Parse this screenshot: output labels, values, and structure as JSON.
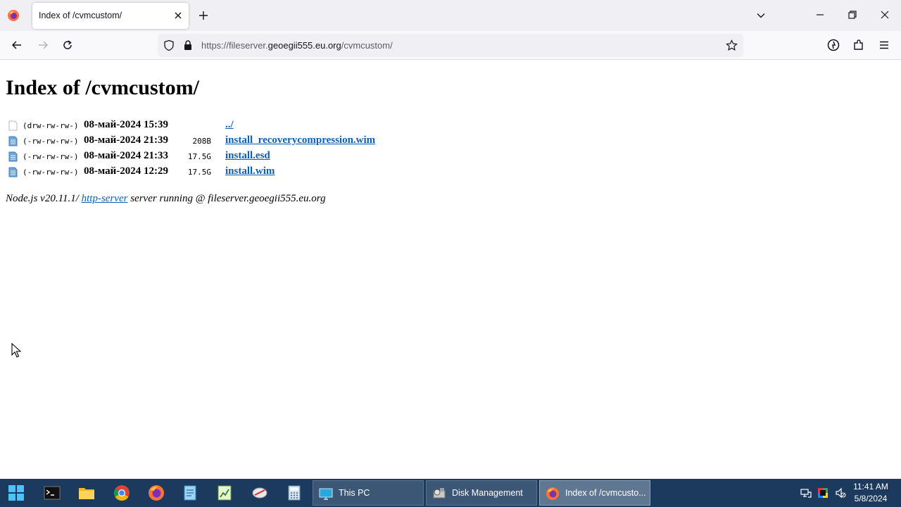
{
  "browser": {
    "tab_title": "Index of /cvmcustom/",
    "url_prefix": "https://fileserver.",
    "url_domain": "geoegii555.eu.org",
    "url_path": "/cvmcustom/"
  },
  "page": {
    "heading": "Index of /cvmcustom/",
    "entries": [
      {
        "perm": "(drw-rw-rw-)",
        "date": "08-май-2024 15:39",
        "size": "",
        "name": "../",
        "type": "directory"
      },
      {
        "perm": "(-rw-rw-rw-)",
        "date": "08-май-2024 21:39",
        "size": "208B",
        "name": "install_recoverycompression.wim",
        "type": "file"
      },
      {
        "perm": "(-rw-rw-rw-)",
        "date": "08-май-2024 21:33",
        "size": "17.5G",
        "name": "install.esd",
        "type": "file"
      },
      {
        "perm": "(-rw-rw-rw-)",
        "date": "08-май-2024 12:29",
        "size": "17.5G",
        "name": "install.wim",
        "type": "file"
      }
    ],
    "footer": {
      "prefix": "Node.js v20.11.1/ ",
      "link": "http-server",
      "suffix": " server running @ fileserver.geoegii555.eu.org"
    }
  },
  "taskbar": {
    "pinned": [
      "start-icon",
      "terminal-icon",
      "file-explorer-icon",
      "chrome-icon",
      "firefox-icon",
      "notepad-icon",
      "spreadsheet-icon",
      "tool-icon",
      "calculator-icon"
    ],
    "tasks": [
      {
        "label": "This PC",
        "icon": "monitor-icon",
        "active": false
      },
      {
        "label": "Disk Management",
        "icon": "disk-management-icon",
        "active": false
      },
      {
        "label": "Index of /cvmcusto...",
        "icon": "firefox-icon",
        "active": true
      }
    ],
    "clock_time": "11:41 AM",
    "clock_date": "5/8/2024"
  },
  "colors": {
    "link": "#0b5fb3",
    "taskbar": "#1c3a5e",
    "tabstrip": "#f0f0f4"
  }
}
